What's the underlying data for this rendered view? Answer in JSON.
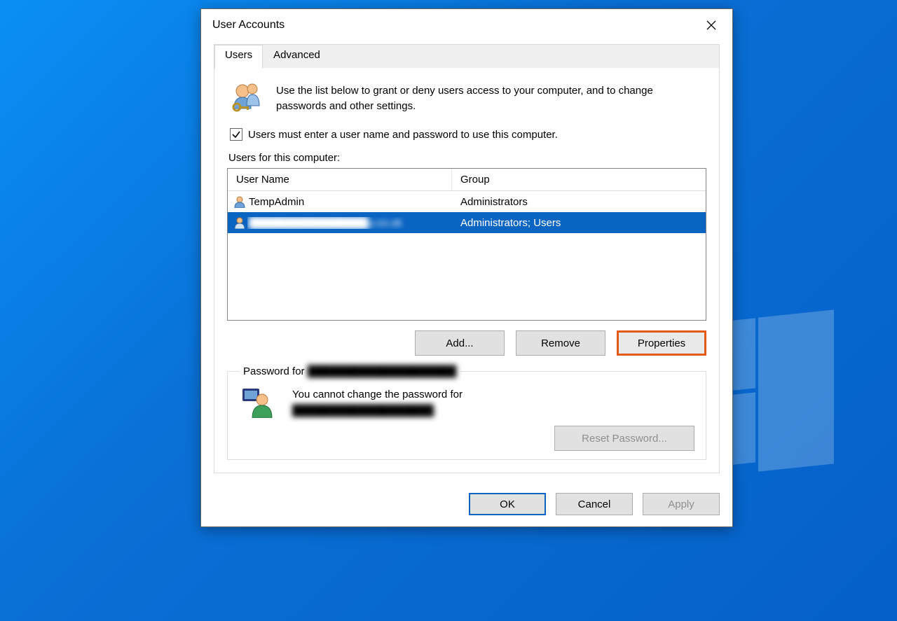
{
  "window": {
    "title": "User Accounts"
  },
  "tabs": {
    "users": "Users",
    "advanced": "Advanced"
  },
  "intro": {
    "text": "Use the list below to grant or deny users access to your computer, and to change passwords and other settings."
  },
  "checkbox": {
    "label": "Users must enter a user name and password to use this computer.",
    "checked": true
  },
  "list": {
    "caption": "Users for this computer:",
    "columns": {
      "user": "User Name",
      "group": "Group"
    },
    "rows": [
      {
        "user": "TempAdmin",
        "group": "Administrators",
        "selected": false,
        "blurred": false
      },
      {
        "user": "████████████████p.co.uk",
        "group": "Administrators; Users",
        "selected": true,
        "blurred": true
      }
    ]
  },
  "actions": {
    "add": "Add...",
    "remove": "Remove",
    "properties": "Properties"
  },
  "password_group": {
    "legend_prefix": "Password for ",
    "legend_user": "████████████████████",
    "line1": "You cannot change the password for",
    "line2_user": "███████████████████.",
    "reset_button": "Reset Password..."
  },
  "dialog_buttons": {
    "ok": "OK",
    "cancel": "Cancel",
    "apply": "Apply"
  }
}
